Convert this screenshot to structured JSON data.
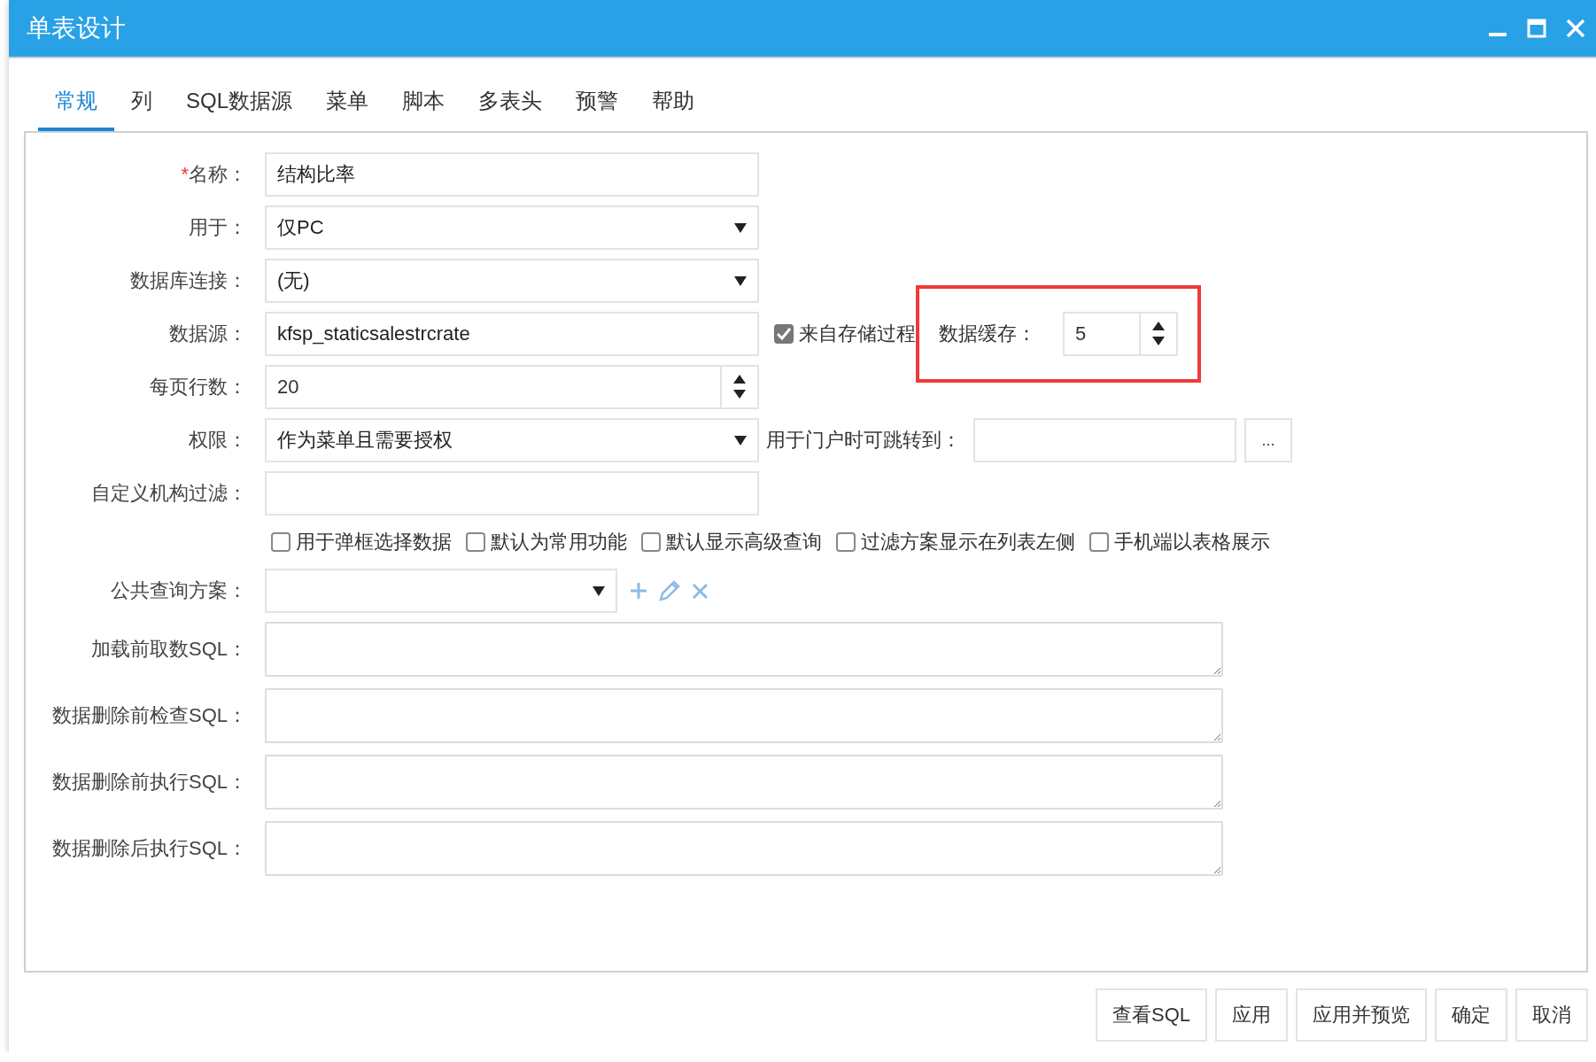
{
  "window": {
    "title": "单表设计"
  },
  "tabs": [
    {
      "label": "常规",
      "selected": true
    },
    {
      "label": "列",
      "selected": false
    },
    {
      "label": "SQL数据源",
      "selected": false
    },
    {
      "label": "菜单",
      "selected": false
    },
    {
      "label": "脚本",
      "selected": false
    },
    {
      "label": "多表头",
      "selected": false
    },
    {
      "label": "预警",
      "selected": false
    },
    {
      "label": "帮助",
      "selected": false
    }
  ],
  "fields": [
    {
      "kind": "text",
      "required_mark": "*",
      "label": "名称：",
      "value": "结构比率"
    },
    {
      "kind": "select",
      "label": "用于：",
      "value": "仅PC"
    },
    {
      "kind": "select",
      "label": "数据库连接：",
      "value": "(无)"
    },
    {
      "kind": "text",
      "label": "数据源：",
      "value": "kfsp_staticsalestrcrate",
      "checkbox": {
        "label": "来自存储过程",
        "checked": true
      },
      "cache": {
        "label": "数据缓存：",
        "value": "5",
        "highlighted": true
      }
    },
    {
      "kind": "spinner",
      "label": "每页行数：",
      "value": "20"
    },
    {
      "kind": "select",
      "label": "权限：",
      "value": "作为菜单且需要授权",
      "portal": {
        "label": "用于门户时可跳转到：",
        "button": "..."
      }
    },
    {
      "kind": "text",
      "label": "自定义机构过滤："
    },
    {
      "kind": "options",
      "options": [
        {
          "label": "用于弹框选择数据",
          "checked": false
        },
        {
          "label": "默认为常用功能",
          "checked": false
        },
        {
          "label": "默认显示高级查询",
          "checked": false
        },
        {
          "label": "过滤方案显示在列表左侧",
          "checked": false
        },
        {
          "label": "手机端以表格展示",
          "checked": false
        }
      ]
    },
    {
      "kind": "scheme",
      "label": "公共查询方案："
    },
    {
      "kind": "sql",
      "label": "加载前取数SQL："
    },
    {
      "kind": "sql",
      "label": "数据删除前检查SQL："
    },
    {
      "kind": "sql",
      "label": "数据删除前执行SQL："
    },
    {
      "kind": "sql",
      "label": "数据删除后执行SQL："
    }
  ],
  "buttons": [
    "查看SQL",
    "应用",
    "应用并预览",
    "确定",
    "取消"
  ]
}
